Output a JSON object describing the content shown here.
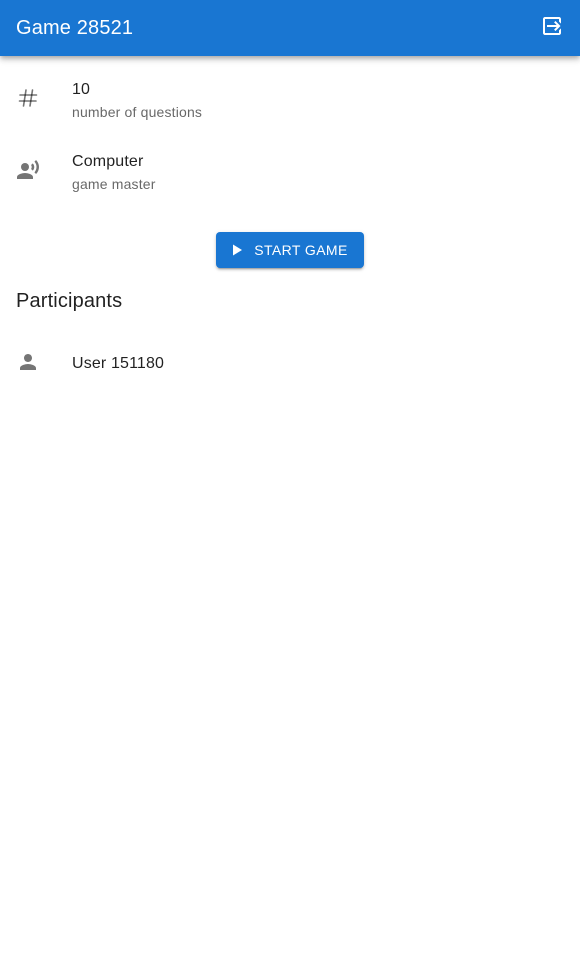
{
  "app_bar": {
    "title": "Game 28521",
    "logout_icon": "logout-icon",
    "background_color": "#1976d2"
  },
  "settings": [
    {
      "icon": "hash-icon",
      "primary": "10",
      "secondary": "number of questions"
    },
    {
      "icon": "record-voice-icon",
      "primary": "Computer",
      "secondary": "game master"
    }
  ],
  "start_button": {
    "label": "Start Game",
    "icon": "play-icon"
  },
  "participants_section": {
    "title": "Participants",
    "items": [
      {
        "icon": "person-icon",
        "name": "User 151180"
      }
    ]
  }
}
